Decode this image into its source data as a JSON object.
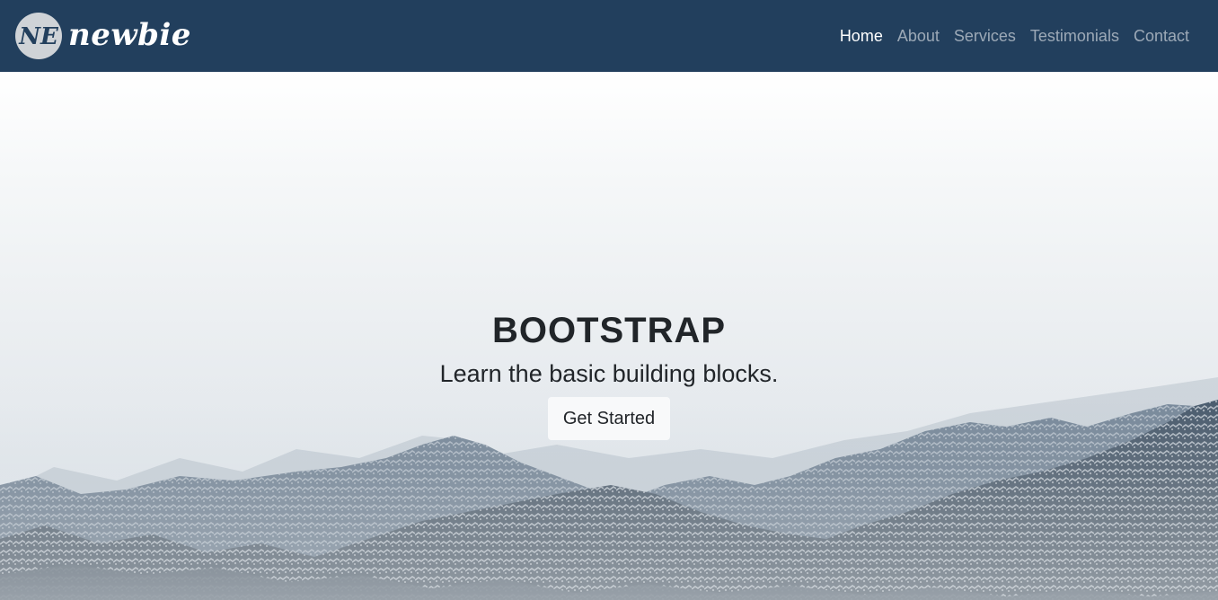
{
  "navbar": {
    "brand_name": "newbie",
    "brand_badge_text": "NE",
    "background_color": "#223f5d",
    "items": [
      {
        "label": "Home",
        "active": true
      },
      {
        "label": "About",
        "active": false
      },
      {
        "label": "Services",
        "active": false
      },
      {
        "label": "Testimonials",
        "active": false
      },
      {
        "label": "Contact",
        "active": false
      }
    ]
  },
  "hero": {
    "title": "BOOTSTRAP",
    "subtitle": "Learn the basic building blocks.",
    "cta_label": "Get Started",
    "background_image": "snowy-mountains-in-fog"
  }
}
